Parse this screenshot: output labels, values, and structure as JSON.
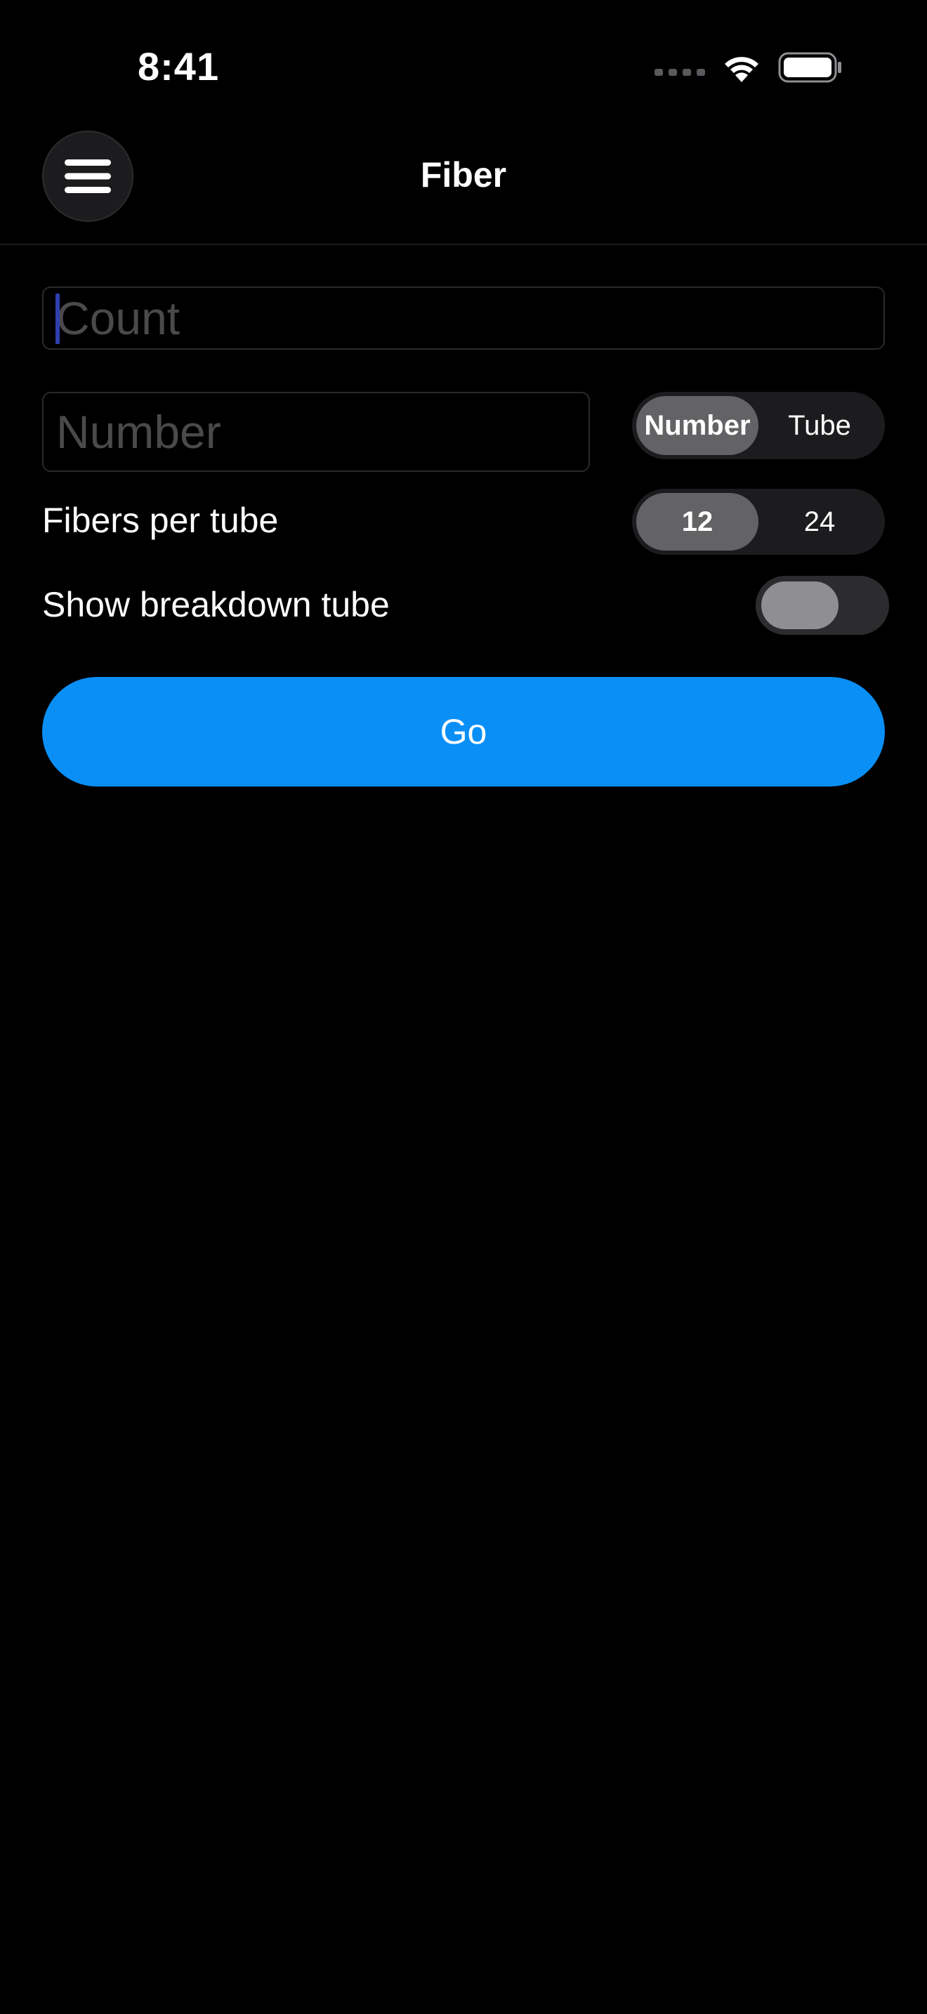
{
  "status_bar": {
    "time": "8:41",
    "signal_icon": "cellular-dots-icon",
    "wifi_icon": "wifi-icon",
    "battery_icon": "battery-icon"
  },
  "header": {
    "title": "Fiber",
    "menu_icon": "hamburger-menu-icon"
  },
  "form": {
    "count_input": {
      "value": "",
      "placeholder": "Count"
    },
    "number_input": {
      "value": "",
      "placeholder": "Number"
    },
    "mode_segment": {
      "options": [
        "Number",
        "Tube"
      ],
      "selected": "Number"
    },
    "fibers_per_tube": {
      "label": "Fibers per tube",
      "options": [
        "12",
        "24"
      ],
      "selected": "12"
    },
    "show_breakdown": {
      "label": "Show breakdown tube",
      "on": false
    },
    "go_label": "Go"
  },
  "colors": {
    "background": "#000000",
    "accent": "#0a8ff7",
    "segment_bg": "#1c1c1e",
    "segment_selected": "#636366",
    "placeholder": "#4a4a4c"
  }
}
